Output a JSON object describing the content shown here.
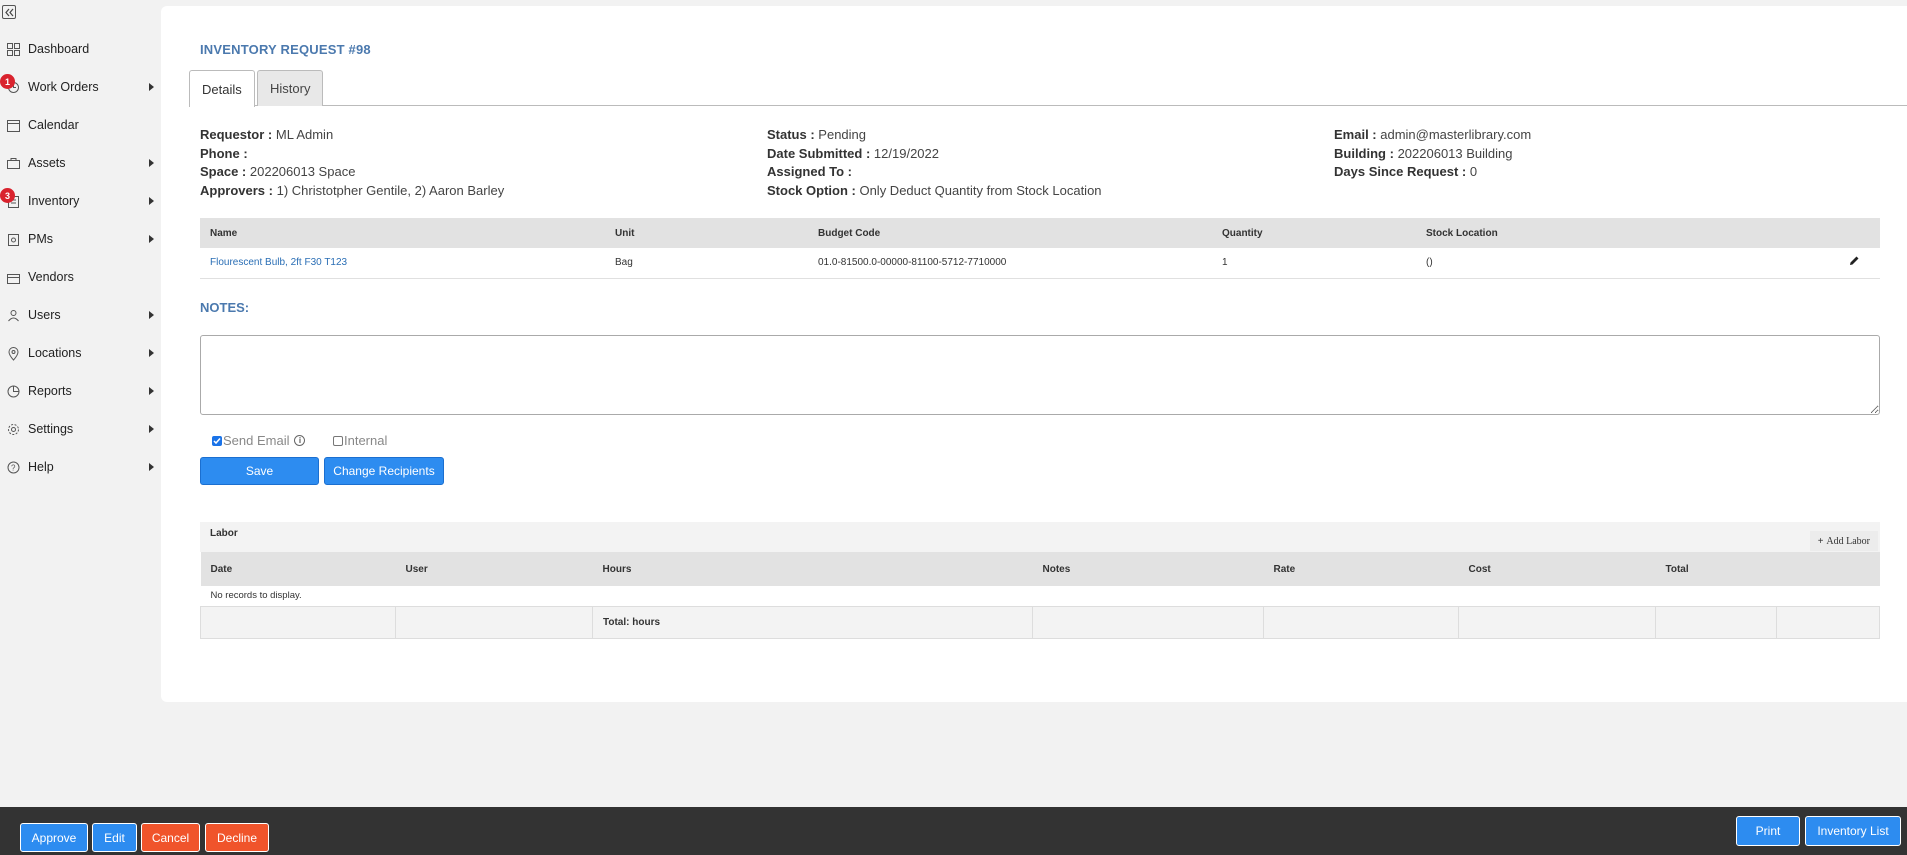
{
  "sidebar": {
    "items": [
      {
        "label": "Dashboard",
        "icon": "dashboard-icon",
        "has_arrow": false,
        "badge": null
      },
      {
        "label": "Work Orders",
        "icon": "work-orders-icon",
        "has_arrow": true,
        "badge": "1"
      },
      {
        "label": "Calendar",
        "icon": "calendar-icon",
        "has_arrow": false,
        "badge": null
      },
      {
        "label": "Assets",
        "icon": "assets-icon",
        "has_arrow": true,
        "badge": null
      },
      {
        "label": "Inventory",
        "icon": "inventory-icon",
        "has_arrow": true,
        "badge": "3"
      },
      {
        "label": "PMs",
        "icon": "pms-icon",
        "has_arrow": true,
        "badge": null
      },
      {
        "label": "Vendors",
        "icon": "vendors-icon",
        "has_arrow": false,
        "badge": null
      },
      {
        "label": "Users",
        "icon": "users-icon",
        "has_arrow": true,
        "badge": null
      },
      {
        "label": "Locations",
        "icon": "location-pin-icon",
        "has_arrow": true,
        "badge": null
      },
      {
        "label": "Reports",
        "icon": "reports-icon",
        "has_arrow": true,
        "badge": null
      },
      {
        "label": "Settings",
        "icon": "gear-icon",
        "has_arrow": true,
        "badge": null
      },
      {
        "label": "Help",
        "icon": "help-icon",
        "has_arrow": true,
        "badge": null
      }
    ]
  },
  "page": {
    "title": "INVENTORY REQUEST #98",
    "tabs": [
      {
        "label": "Details"
      },
      {
        "label": "History"
      }
    ]
  },
  "info": {
    "col1": [
      {
        "label": "Requestor :",
        "value": "ML Admin"
      },
      {
        "label": "Phone :",
        "value": ""
      },
      {
        "label": "Space :",
        "value": "202206013 Space"
      },
      {
        "label": "Approvers :",
        "value": "1) Christotpher Gentile, 2) Aaron Barley"
      }
    ],
    "col2": [
      {
        "label": "Status :",
        "value": "Pending"
      },
      {
        "label": "Date Submitted :",
        "value": "12/19/2022"
      },
      {
        "label": "Assigned To :",
        "value": ""
      },
      {
        "label": "Stock Option :",
        "value": "Only Deduct Quantity from Stock Location"
      }
    ],
    "col3": [
      {
        "label": "Email :",
        "value": "admin@masterlibrary.com"
      },
      {
        "label": "Building :",
        "value": "202206013 Building"
      },
      {
        "label": "Days Since Request :",
        "value": "0"
      }
    ]
  },
  "items_table": {
    "headers": [
      "Name",
      "Unit",
      "Budget Code",
      "Quantity",
      "Stock Location"
    ],
    "rows": [
      {
        "name": "Flourescent Bulb, 2ft F30 T123",
        "unit": "Bag",
        "budget_code": "01.0-81500.0-00000-81100-5712-7710000",
        "quantity": "1",
        "stock_location": "()"
      }
    ]
  },
  "notes": {
    "label": "NOTES:",
    "value": "",
    "send_email_label": "Send Email",
    "send_email_checked": true,
    "internal_label": "Internal",
    "internal_checked": false,
    "save_label": "Save",
    "change_recipients_label": "Change Recipients"
  },
  "labor": {
    "title": "Labor",
    "add_label": "Add Labor",
    "headers": [
      "Date",
      "User",
      "Hours",
      "Notes",
      "Rate",
      "Cost",
      "Total"
    ],
    "empty_text": "No records to display.",
    "total_label": "Total: hours"
  },
  "bottom_bar": {
    "approve": "Approve",
    "edit": "Edit",
    "cancel": "Cancel",
    "decline": "Decline",
    "print": "Print",
    "inventory_list": "Inventory List"
  }
}
